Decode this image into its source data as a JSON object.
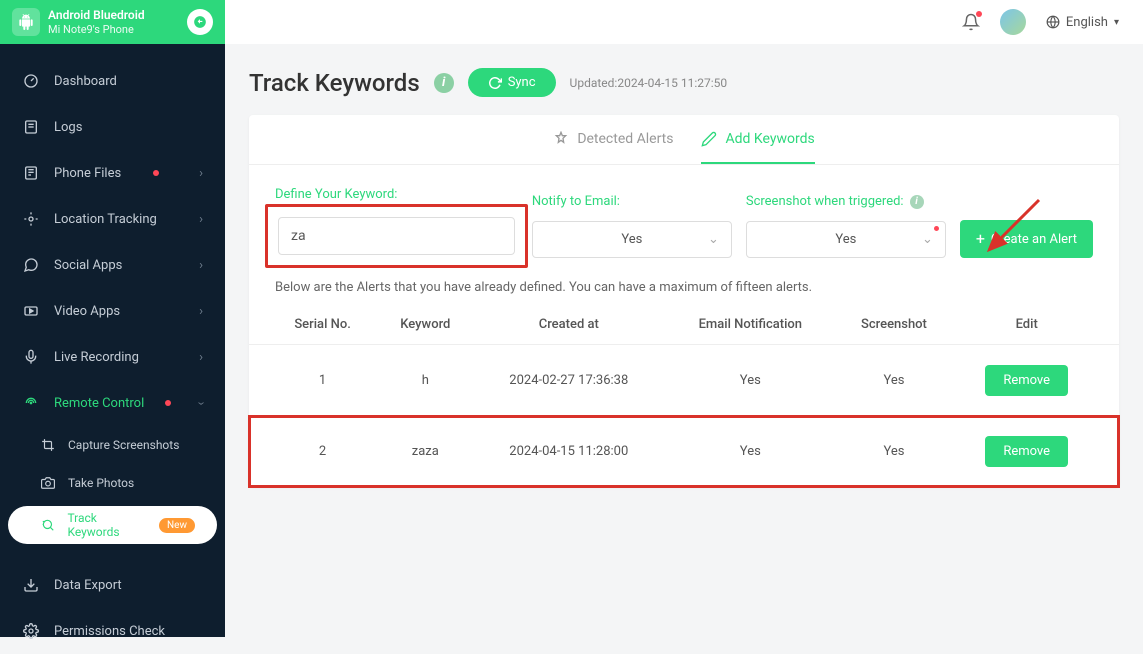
{
  "device": {
    "title": "Android Bluedroid",
    "subtitle": "Mi Note9's Phone"
  },
  "sidebar": {
    "items": [
      {
        "label": "Dashboard"
      },
      {
        "label": "Logs"
      },
      {
        "label": "Phone Files"
      },
      {
        "label": "Location Tracking"
      },
      {
        "label": "Social Apps"
      },
      {
        "label": "Video Apps"
      },
      {
        "label": "Live Recording"
      },
      {
        "label": "Remote Control"
      },
      {
        "label": "Data Export"
      },
      {
        "label": "Permissions Check"
      }
    ],
    "sub": {
      "capture": "Capture Screenshots",
      "photos": "Take Photos",
      "track": "Track Keywords",
      "new_badge": "New"
    }
  },
  "topbar": {
    "language": "English"
  },
  "page": {
    "title": "Track Keywords",
    "sync": "Sync",
    "updated": "Updated:2024-04-15 11:27:50"
  },
  "tabs": {
    "detected": "Detected Alerts",
    "add": "Add Keywords"
  },
  "form": {
    "keyword_label": "Define Your Keyword:",
    "keyword_value": "za",
    "notify_label": "Notify to Email:",
    "notify_value": "Yes",
    "screenshot_label": "Screenshot when triggered:",
    "screenshot_value": "Yes",
    "create_btn": "Create an Alert"
  },
  "hint": "Below are the Alerts that you have already defined. You can have a maximum of fifteen alerts.",
  "table": {
    "headers": {
      "serial": "Serial No.",
      "keyword": "Keyword",
      "created": "Created at",
      "email": "Email Notification",
      "screenshot": "Screenshot",
      "edit": "Edit"
    },
    "rows": [
      {
        "serial": "1",
        "keyword": "h",
        "created": "2024-02-27 17:36:38",
        "email": "Yes",
        "screenshot": "Yes",
        "btn": "Remove"
      },
      {
        "serial": "2",
        "keyword": "zaza",
        "created": "2024-04-15 11:28:00",
        "email": "Yes",
        "screenshot": "Yes",
        "btn": "Remove"
      }
    ]
  }
}
